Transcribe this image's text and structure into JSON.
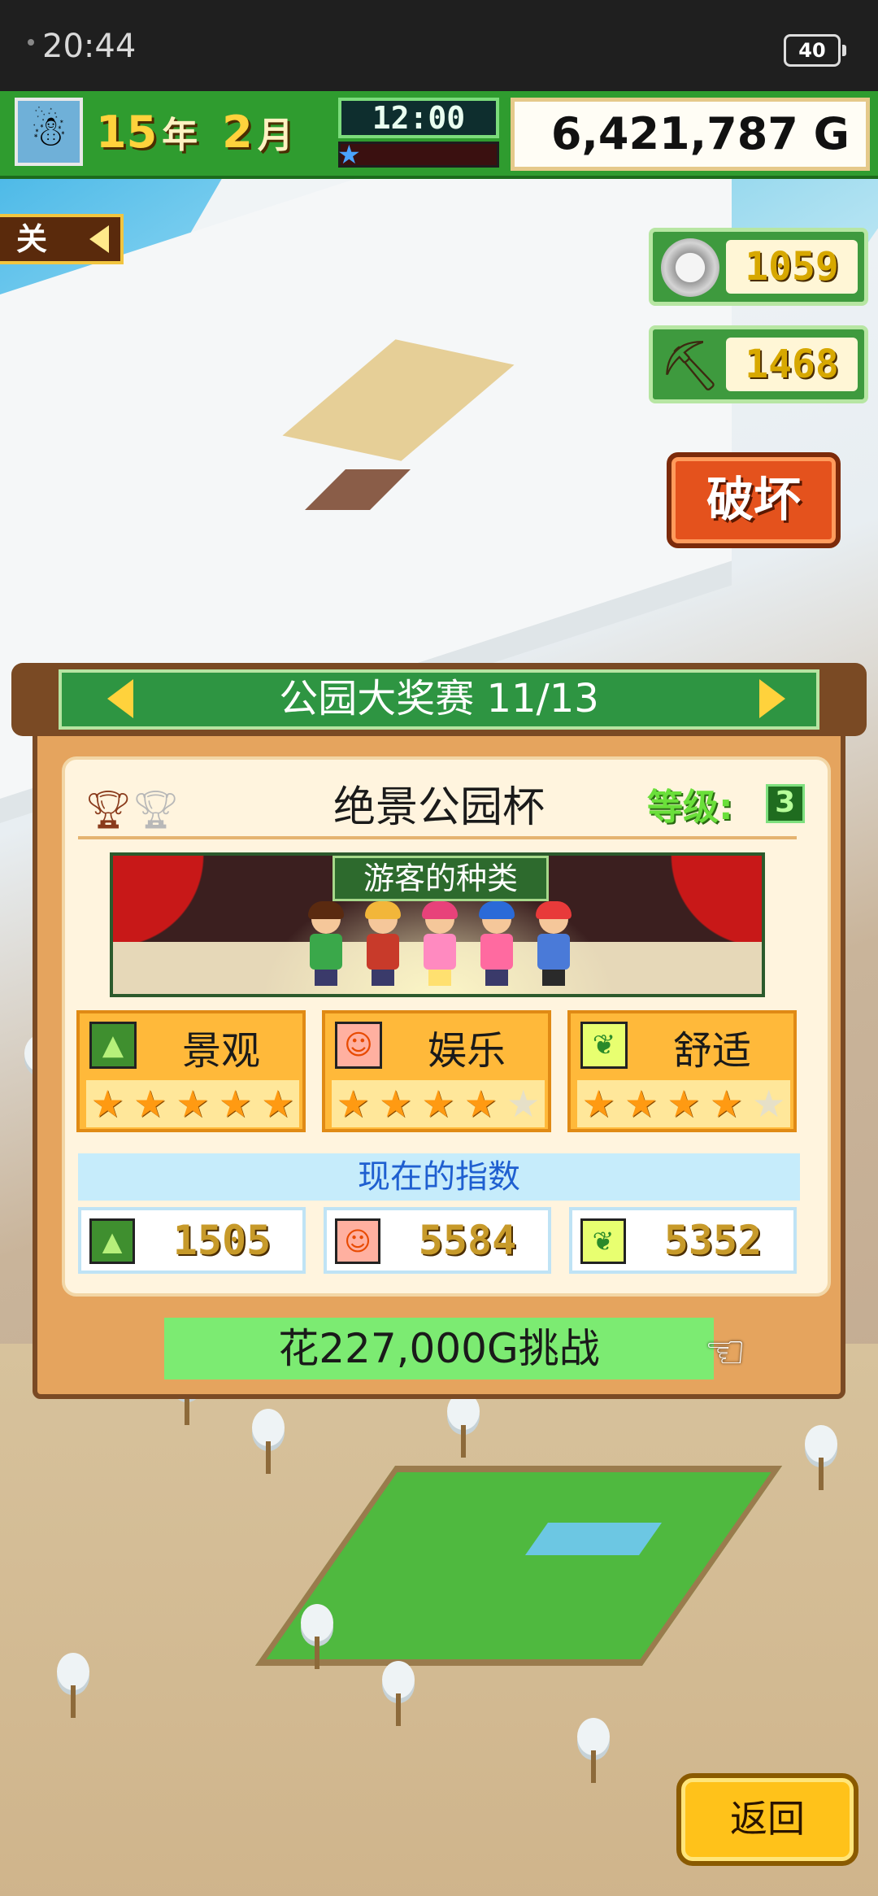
{
  "status_bar": {
    "time": "20:44",
    "battery": "40"
  },
  "hud": {
    "year": "15",
    "year_unit": "年",
    "month": "2",
    "month_unit": "月",
    "clock": "12:00",
    "money": "6,421,787 G",
    "avatar_icon": "snowman-icon"
  },
  "left_flag": {
    "label": "关"
  },
  "resources": {
    "coins": {
      "icon": "coin-icon",
      "value": "1059"
    },
    "pickaxe": {
      "icon": "pickaxe-icon",
      "value": "1468"
    }
  },
  "destroy_button": {
    "label": "破坏"
  },
  "contest": {
    "header": "公园大奖赛 11/13",
    "cup_name": "绝景公园杯",
    "grade_label": "等级:",
    "grade_value": "3",
    "visitor_tag": "游客的种类",
    "categories": [
      {
        "label": "景观",
        "icon": "landscape-icon",
        "stars": 5
      },
      {
        "label": "娱乐",
        "icon": "smiley-icon",
        "stars": 4
      },
      {
        "label": "舒适",
        "icon": "leaf-icon",
        "stars": 4
      }
    ],
    "max_stars": 5,
    "index_title": "现在的指数",
    "indexes": [
      {
        "icon": "landscape-icon",
        "value": "1505"
      },
      {
        "icon": "smiley-icon",
        "value": "5584"
      },
      {
        "icon": "leaf-icon",
        "value": "5352"
      }
    ],
    "challenge_label": "花227,000G挑战"
  },
  "back_button": {
    "label": "返回"
  },
  "colors": {
    "hud_green": "#2f9c2f",
    "panel_orange": "#e5a45e",
    "star_on": "#ff9a12",
    "challenge_green": "#7ceb72",
    "index_blue": "#1f5fd0"
  }
}
